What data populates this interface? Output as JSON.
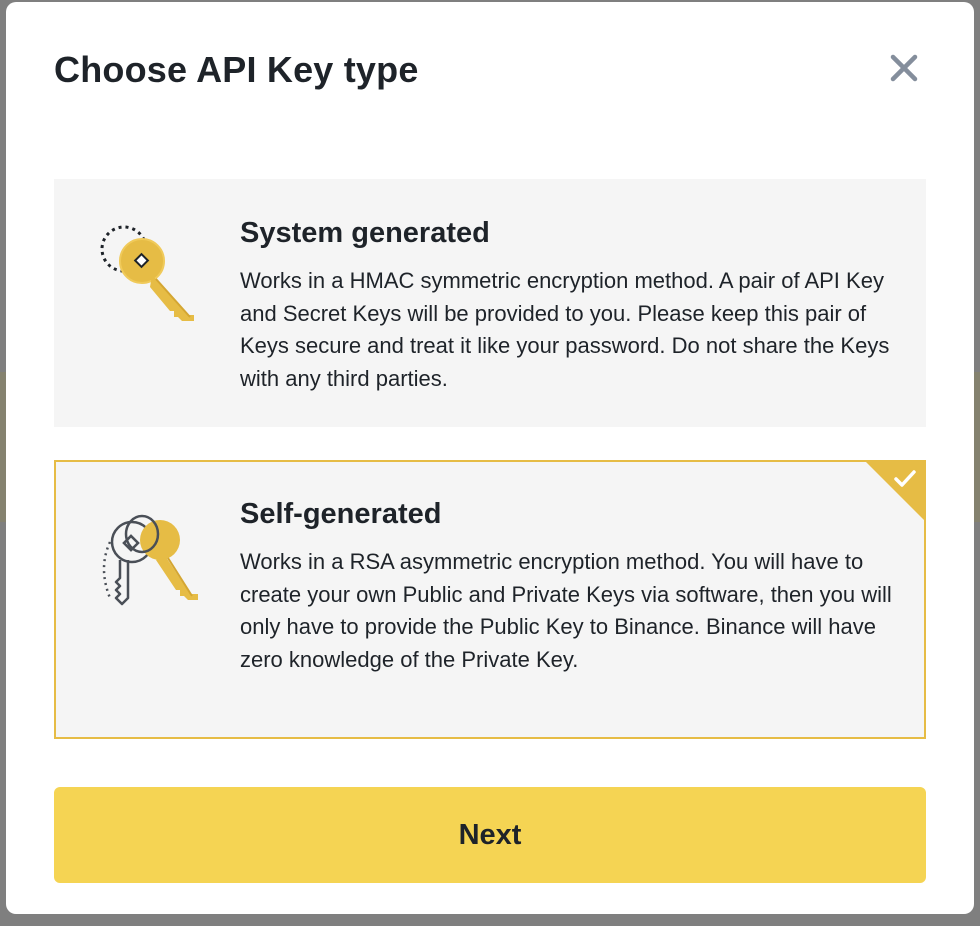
{
  "modal": {
    "title": "Choose API Key type",
    "close_icon": "close-icon"
  },
  "options": [
    {
      "title": "System generated",
      "description": "Works in a HMAC symmetric encryption method. A pair of API Key and Secret Keys will be provided to you. Please keep this pair of Keys secure and treat it like your password. Do not share the Keys with any third parties.",
      "icon": "single-key-icon",
      "selected": false
    },
    {
      "title": "Self-generated",
      "description": "Works in a RSA asymmetric encryption method. You will have to create your own Public and Private Keys via software, then you will only have to provide the Public Key to Binance. Binance will have zero knowledge of the Private Key.",
      "icon": "key-pair-icon",
      "selected": true
    }
  ],
  "next_label": "Next",
  "colors": {
    "accent": "#e6bc45",
    "button": "#f5d453",
    "card_bg": "#f5f5f5",
    "text": "#1e2329"
  }
}
